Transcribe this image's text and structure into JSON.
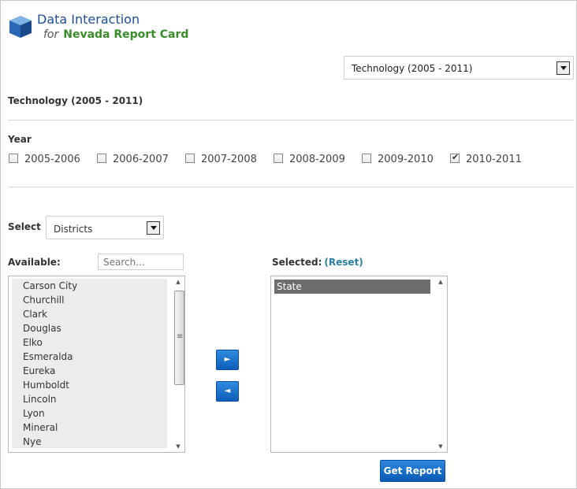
{
  "header": {
    "title": "Data Interaction",
    "for_text": "for",
    "subtitle": "Nevada Report Card",
    "logo_icon": "blue-cube-icon"
  },
  "report_select": {
    "value": "Technology (2005 - 2011)"
  },
  "section_title": "Technology (2005 - 2011)",
  "year": {
    "label": "Year",
    "options": [
      {
        "label": "2005-2006",
        "checked": false
      },
      {
        "label": "2006-2007",
        "checked": false
      },
      {
        "label": "2007-2008",
        "checked": false
      },
      {
        "label": "2008-2009",
        "checked": false
      },
      {
        "label": "2009-2010",
        "checked": false
      },
      {
        "label": "2010-2011",
        "checked": true
      }
    ]
  },
  "scope_select": {
    "label": "Select",
    "value": "Districts"
  },
  "available": {
    "label": "Available:",
    "search_placeholder": "Search...",
    "items": [
      "Carson City",
      "Churchill",
      "Clark",
      "Douglas",
      "Elko",
      "Esmeralda",
      "Eureka",
      "Humboldt",
      "Lincoln",
      "Lyon",
      "Mineral",
      "Nye"
    ]
  },
  "selected": {
    "label": "Selected:",
    "reset_label": "(Reset)",
    "items": [
      "State"
    ]
  },
  "buttons": {
    "add_icon": "right-triangle-icon",
    "remove_icon": "left-triangle-icon",
    "get_report": "Get Report"
  },
  "colors": {
    "title_blue": "#1f4f8f",
    "subtitle_green": "#3a8c2a",
    "button_blue": "#1a6fca",
    "link_teal": "#2b7fa0"
  }
}
